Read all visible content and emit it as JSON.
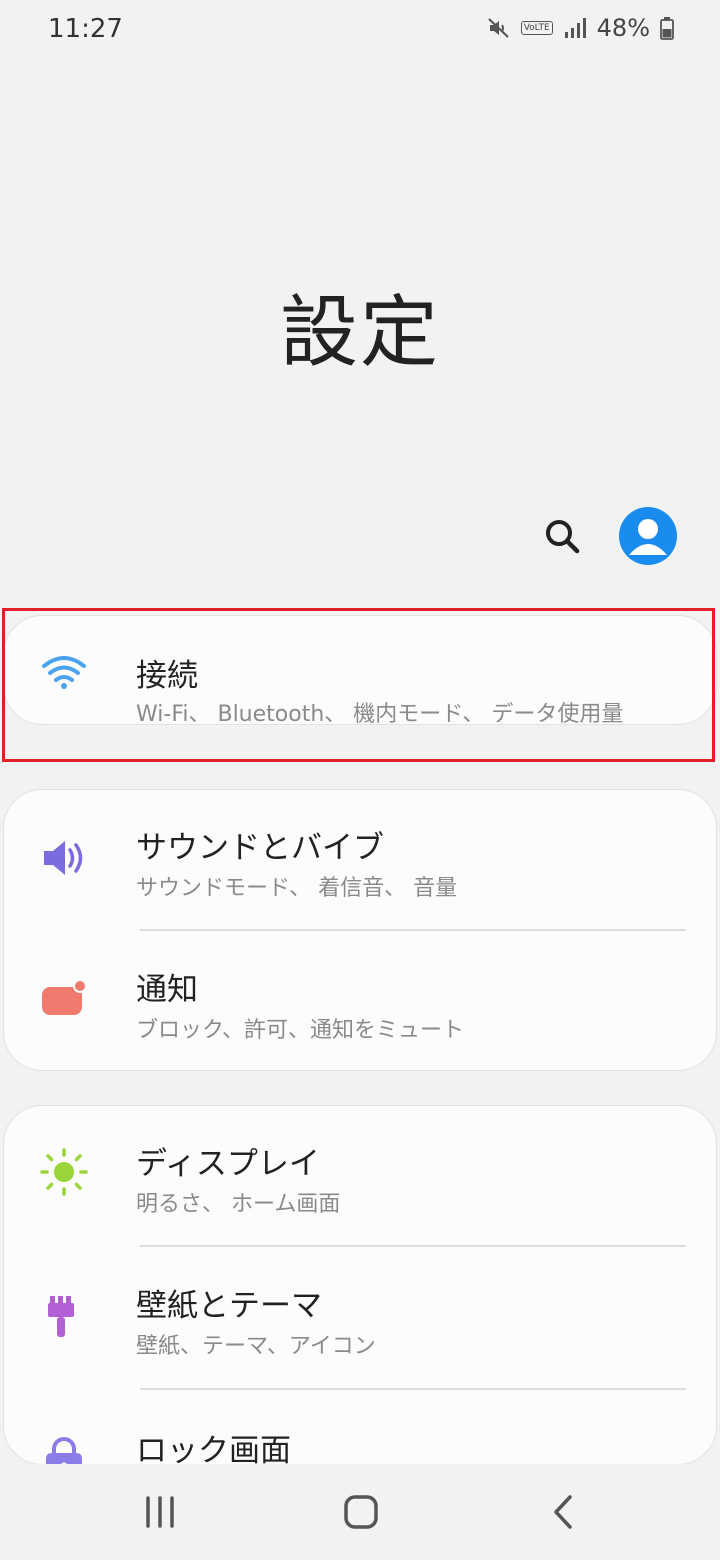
{
  "status_bar": {
    "time": "11:27",
    "volte": "VoLTE",
    "battery": "48%"
  },
  "page": {
    "title": "設定"
  },
  "colors": {
    "accent": "#1a8cf0",
    "wifi": "#4aa3ee",
    "sound": "#7b6be0",
    "notification": "#f07a6e",
    "display": "#9bd33a",
    "wallpaper": "#b35fd6",
    "lock": "#8a7de8",
    "highlight": "#e01f26"
  },
  "sections": [
    {
      "items": [
        {
          "icon": "wifi-icon",
          "title": "接続",
          "subtitle": "Wi-Fi、 Bluetooth、 機内モード、 データ使用量"
        }
      ]
    },
    {
      "items": [
        {
          "icon": "speaker-icon",
          "title": "サウンドとバイブ",
          "subtitle": "サウンドモード、 着信音、 音量"
        },
        {
          "icon": "notification-icon",
          "title": "通知",
          "subtitle": "ブロック、許可、通知をミュート"
        }
      ]
    },
    {
      "items": [
        {
          "icon": "brightness-icon",
          "title": "ディスプレイ",
          "subtitle": "明るさ、 ホーム画面"
        },
        {
          "icon": "paintbrush-icon",
          "title": "壁紙とテーマ",
          "subtitle": "壁紙、テーマ、アイコン"
        },
        {
          "icon": "lock-icon",
          "title": "ロック画面",
          "subtitle": ""
        }
      ]
    }
  ]
}
